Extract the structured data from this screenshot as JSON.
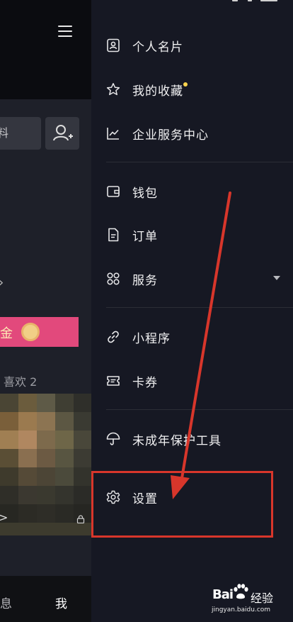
{
  "left_panel": {
    "edit_profile_text": "料",
    "tab_likes": "喜欢 2",
    "promo_text": "金",
    "bottom_nav": {
      "messages": "息",
      "me": "我"
    }
  },
  "drawer": {
    "items": [
      {
        "label": "个人名片",
        "icon": "id-card-icon"
      },
      {
        "label": "我的收藏",
        "icon": "star-icon",
        "badge_dot": true
      },
      {
        "label": "企业服务中心",
        "icon": "chart-line-icon"
      },
      {
        "label": "钱包",
        "icon": "wallet-icon"
      },
      {
        "label": "订单",
        "icon": "order-document-icon"
      },
      {
        "label": "服务",
        "icon": "services-grid-icon",
        "expandable": true
      },
      {
        "label": "小程序",
        "icon": "mini-program-link-icon"
      },
      {
        "label": "卡券",
        "icon": "coupon-ticket-icon"
      },
      {
        "label": "未成年保护工具",
        "icon": "umbrella-icon"
      },
      {
        "label": "设置",
        "icon": "settings-gear-icon"
      }
    ]
  },
  "watermark": {
    "logo": "Bai",
    "logo_suffix": "经验",
    "url": "jingyan.baidu.com"
  },
  "colors": {
    "accent_dot": "#fbd34d",
    "annotation": "#d8362b",
    "promo": "#e2497c"
  }
}
